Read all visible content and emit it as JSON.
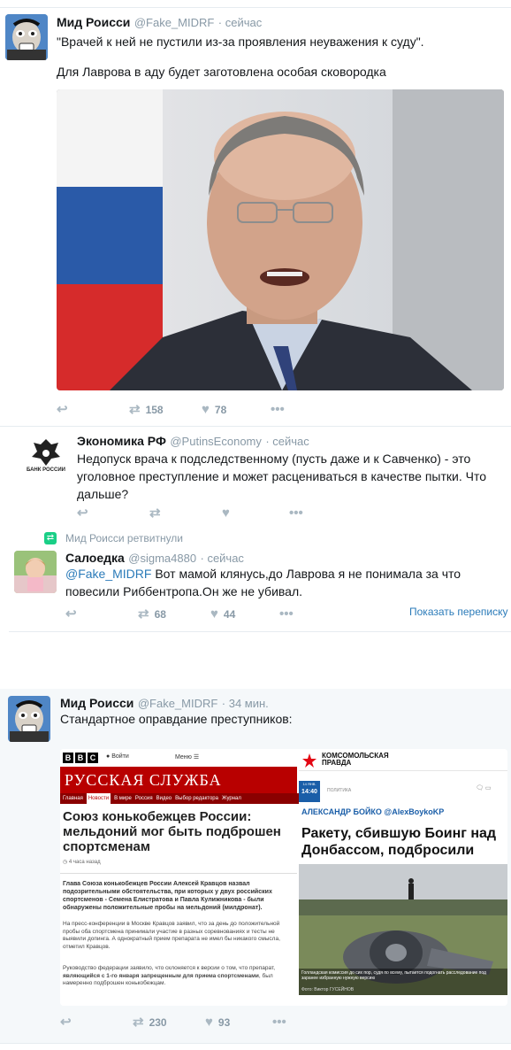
{
  "tweet1": {
    "name": "Мид Роисси",
    "handle": "@Fake_MIDRF",
    "time": "· сейчас",
    "text_line1": "\"Врачей к ней не пустили из-за проявления неуважения к суду\".",
    "text_line2": "Для Лаврова в аду будет заготовлена особая сковородка",
    "retweets": "158",
    "likes": "78"
  },
  "reply1": {
    "name": "Экономика РФ",
    "handle": "@PutinsEconomy",
    "time": "· сейчас",
    "avatar_label": "БАНК РОССИИ",
    "text": "Недопуск врача к подследственному (пусть даже и к Савченко) - это уголовное преступление и может расцениваться в качестве пытки. Что дальше?"
  },
  "retweet_notice": "Мид Роисси ретвитнули",
  "reply2": {
    "name": "Салоедка",
    "handle": "@sigma4880",
    "time": "· сейчас",
    "mention": "@Fake_MIDRF",
    "text": " Вот мамой клянусь,до Лаврова я не понимала за что повесили Риббентропа.Он же не убивал.",
    "retweets": "68",
    "likes": "44",
    "show_conversation": "Показать переписку"
  },
  "tweet2": {
    "name": "Мид Роисси",
    "handle": "@Fake_MIDRF",
    "time": "· 34 мин.",
    "text": "Стандартное оправдание преступников:",
    "retweets": "230",
    "likes": "93",
    "bbc": {
      "logo": "BBC",
      "login": "Войти",
      "menu": "Меню",
      "service": "РУССКАЯ СЛУЖБА",
      "nav": [
        "Главная",
        "Новости",
        "В мире",
        "Россия",
        "Видео",
        "Выбор редактора",
        "Журнал"
      ],
      "headline": "Союз конькобежцев России: мельдоний мог быть подброшен спортсменам",
      "time": "4 часа назад",
      "lead": "Глава Союза конькобежцев России Алексей Кравцов назвал подозрительными обстоятельства, при которых у двух российских спортсменов - Семена Елистратова и Павла Кулижникова - были обнаружены положительные пробы на мельдоний (милдронат).",
      "p2": "На пресс-конференции в Москве Кравцов заявил, что за день до положительной пробы оба спортсмена принимали участие в разных соревнованиях и тесты не выявили допинга. А однократный прием препарата не имел бы никакого смысла, отметил Кравцов.",
      "p3_a": "Руководство федерации заявило, что склоняется к версии о том, что препарат, ",
      "p3_b": "являющийся с 1-го января запрещенным для приема спортсменами",
      "p3_c": ", был намеренно подброшен конькобежцам."
    },
    "kp": {
      "logo_line1": "КОМСОМОЛЬСКАЯ",
      "logo_line2": "ПРАВДА",
      "date": "14 ЯНВ.",
      "clock": "14:40",
      "section": "ПОЛИТИКА",
      "author": "АЛЕКСАНДР БОЙКО @AlexBoykoKP",
      "headline": "Ракету, сбившую Боинг над Донбассом, подбросили",
      "caption": "Голландская комиссия до сих пор, судя по всему, пытается подогнать расследование под заранее избранную нужную версию",
      "photo": "Фото: Виктор ГУСЕЙНОВ"
    }
  },
  "colors": {
    "bbc_red": "#b80000",
    "kp_red": "#e30613",
    "kp_blue": "#1a5ea8",
    "link": "#2b7bb9",
    "muted": "#8899a6",
    "retweet_green": "#19cf86"
  }
}
